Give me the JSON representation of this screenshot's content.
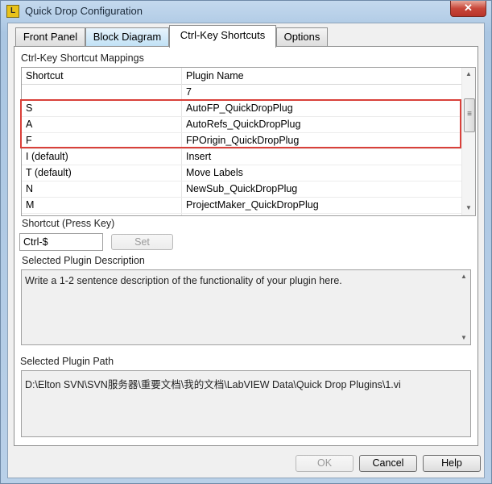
{
  "window": {
    "title": "Quick Drop Configuration",
    "app_icon_text": "L",
    "close_glyph": "✕"
  },
  "tabs": [
    {
      "label": "Front Panel",
      "active": false
    },
    {
      "label": "Block Diagram",
      "active": false
    },
    {
      "label": "Ctrl-Key Shortcuts",
      "active": true
    },
    {
      "label": "Options",
      "active": false
    }
  ],
  "mappings": {
    "section_label": "Ctrl-Key Shortcut Mappings",
    "columns": [
      "Shortcut",
      "Plugin Name"
    ],
    "rows": [
      {
        "shortcut": "",
        "plugin": "7"
      },
      {
        "shortcut": "S",
        "plugin": "AutoFP_QuickDropPlug"
      },
      {
        "shortcut": "A",
        "plugin": "AutoRefs_QuickDropPlug"
      },
      {
        "shortcut": "F",
        "plugin": "FPOrigin_QuickDropPlug"
      },
      {
        "shortcut": "I (default)",
        "plugin": "Insert"
      },
      {
        "shortcut": "T (default)",
        "plugin": "Move Labels"
      },
      {
        "shortcut": "N",
        "plugin": "NewSub_QuickDropPlug"
      },
      {
        "shortcut": "M",
        "plugin": "ProjectMaker_QuickDropPlug"
      }
    ],
    "highlight_color": "#d9403a",
    "scroll_up_glyph": "▲",
    "scroll_down_glyph": "▼",
    "scroll_thumb_glyph": "≡"
  },
  "shortcut": {
    "label": "Shortcut (Press Key)",
    "value": "Ctrl-$",
    "set_label": "Set"
  },
  "description": {
    "label": "Selected Plugin Description",
    "text": "Write a 1-2 sentence description of the functionality of your plugin here."
  },
  "path": {
    "label": "Selected Plugin Path",
    "text": "D:\\Elton SVN\\SVN服务器\\重要文档\\我的文档\\LabVIEW Data\\Quick Drop Plugins\\1.vi"
  },
  "buttons": {
    "ok": "OK",
    "cancel": "Cancel",
    "help": "Help"
  }
}
